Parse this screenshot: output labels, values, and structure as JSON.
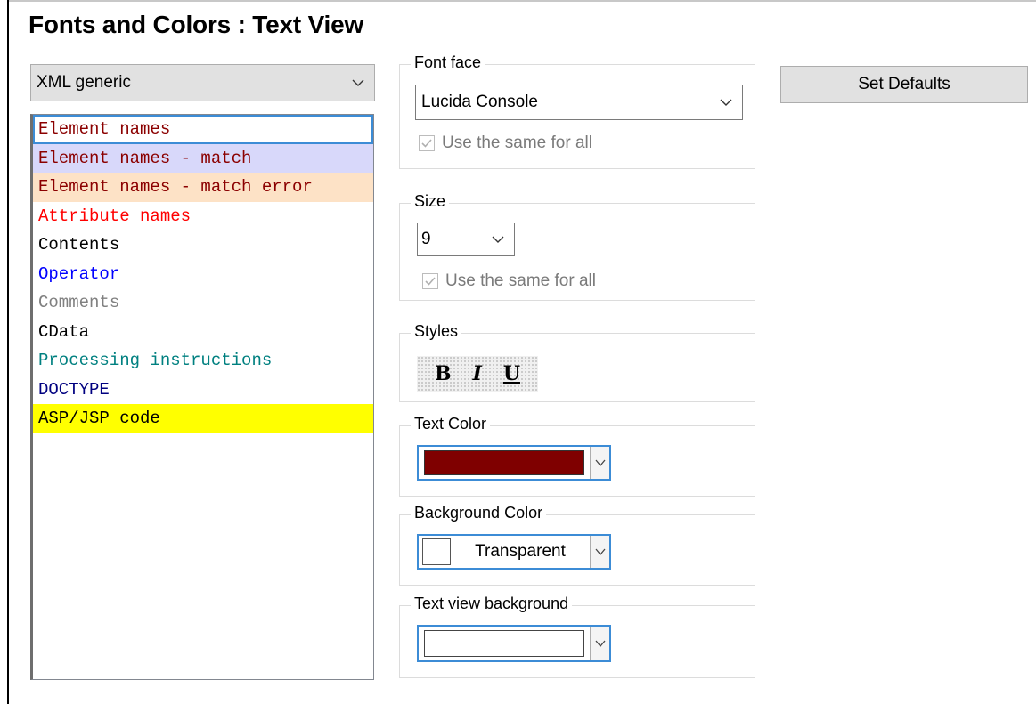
{
  "title": "Fonts and Colors : Text View",
  "type_combo": {
    "value": "XML generic"
  },
  "items": [
    {
      "label": "Element names",
      "color": "#8b0000",
      "bg": "#ffffff",
      "selected": true
    },
    {
      "label": "Element names - match",
      "color": "#8b0000",
      "bg": "#d8d8fa"
    },
    {
      "label": "Element names - match error",
      "color": "#8b0000",
      "bg": "#fde2c6"
    },
    {
      "label": "Attribute names",
      "color": "#ff0000",
      "bg": "#ffffff"
    },
    {
      "label": "Contents",
      "color": "#000000",
      "bg": "#ffffff"
    },
    {
      "label": "Operator",
      "color": "#0000ff",
      "bg": "#ffffff"
    },
    {
      "label": "Comments",
      "color": "#808080",
      "bg": "#ffffff"
    },
    {
      "label": "CData",
      "color": "#000000",
      "bg": "#ffffff"
    },
    {
      "label": "Processing instructions",
      "color": "#008080",
      "bg": "#ffffff"
    },
    {
      "label": "DOCTYPE",
      "color": "#000080",
      "bg": "#ffffff"
    },
    {
      "label": "ASP/JSP code",
      "color": "#000000",
      "bg": "#ffff00"
    }
  ],
  "font_face": {
    "legend": "Font face",
    "value": "Lucida Console",
    "same_label": "Use the same for all"
  },
  "size": {
    "legend": "Size",
    "value": "9",
    "same_label": "Use the same for all"
  },
  "styles": {
    "legend": "Styles",
    "bold": "B",
    "italic": "I",
    "underline": "U"
  },
  "text_color": {
    "legend": "Text Color",
    "swatch": "#7f0000"
  },
  "background_color": {
    "legend": "Background Color",
    "value": "Transparent"
  },
  "text_view_background": {
    "legend": "Text view background"
  },
  "set_defaults_label": "Set Defaults"
}
